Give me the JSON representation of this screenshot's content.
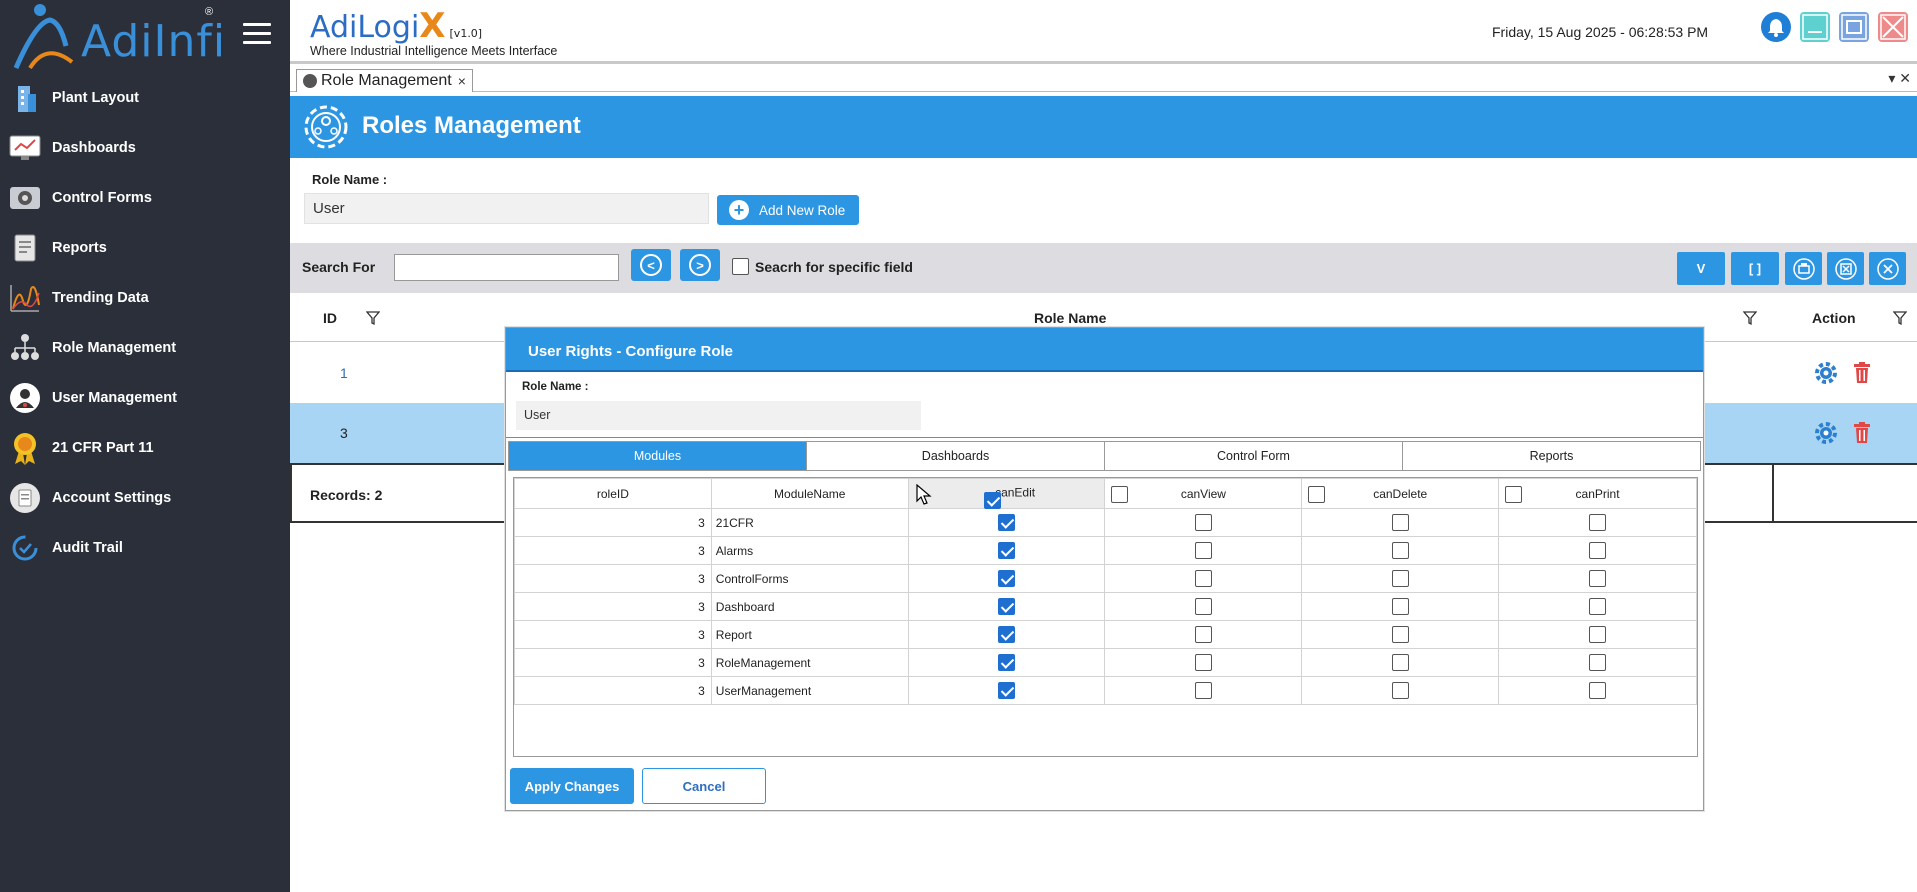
{
  "app": {
    "logo_text_a": "Adi",
    "logo_text_b": "Infi",
    "logo_reg": "®",
    "brand_name": "AdiLogi",
    "brand_x": "X",
    "brand_version": "[v1.0]",
    "brand_tagline": "Where Industrial Intelligence Meets Interface",
    "datetime": "Friday, 15 Aug 2025 - 06:28:53 PM"
  },
  "sidebar": {
    "items": [
      {
        "label": "Plant Layout",
        "icon": "building-icon"
      },
      {
        "label": "Dashboards",
        "icon": "monitor-icon"
      },
      {
        "label": "Control Forms",
        "icon": "control-forms-icon"
      },
      {
        "label": "Reports",
        "icon": "reports-icon"
      },
      {
        "label": "Trending Data",
        "icon": "trend-chart-icon"
      },
      {
        "label": "Role Management",
        "icon": "org-chart-icon"
      },
      {
        "label": "User Management",
        "icon": "user-icon"
      },
      {
        "label": "21 CFR Part 11",
        "icon": "award-badge-icon"
      },
      {
        "label": "Account Settings",
        "icon": "account-settings-icon"
      },
      {
        "label": "Audit Trail",
        "icon": "audit-icon"
      }
    ]
  },
  "doc_tab": {
    "label": "Role Management",
    "close": "×"
  },
  "strip_icons": "▾  ✕",
  "page": {
    "title": "Roles Management",
    "role_name_label": "Role Name :",
    "role_name_value": "User",
    "add_role_label": "Add New Role",
    "plus": "+"
  },
  "search": {
    "label": "Search For",
    "value": "",
    "prev": "<",
    "next": ">",
    "specific_field_label": "Seacrh for specific field",
    "tools": {
      "v": "V",
      "brackets": "[ ]"
    }
  },
  "grid": {
    "headers": {
      "id": "ID",
      "role_name": "Role Name",
      "action": "Action"
    },
    "rows": [
      {
        "id": "1"
      },
      {
        "id": "3"
      }
    ],
    "records_label": "Records: 2"
  },
  "modal": {
    "title": "User Rights - Configure Role",
    "role_name_label": "Role Name :",
    "role_name_value": "User",
    "tabs": [
      "Modules",
      "Dashboards",
      "Control Form",
      "Reports"
    ],
    "active_tab": "Modules",
    "columns": [
      "roleID",
      "ModuleName",
      "canEdit",
      "canView",
      "canDelete",
      "canPrint"
    ],
    "rows": [
      {
        "roleID": "3",
        "ModuleName": "21CFR",
        "canEdit": true,
        "canView": false,
        "canDelete": false,
        "canPrint": false
      },
      {
        "roleID": "3",
        "ModuleName": "Alarms",
        "canEdit": true,
        "canView": false,
        "canDelete": false,
        "canPrint": false
      },
      {
        "roleID": "3",
        "ModuleName": "ControlForms",
        "canEdit": true,
        "canView": false,
        "canDelete": false,
        "canPrint": false
      },
      {
        "roleID": "3",
        "ModuleName": "Dashboard",
        "canEdit": true,
        "canView": false,
        "canDelete": false,
        "canPrint": false
      },
      {
        "roleID": "3",
        "ModuleName": "Report",
        "canEdit": true,
        "canView": false,
        "canDelete": false,
        "canPrint": false
      },
      {
        "roleID": "3",
        "ModuleName": "RoleManagement",
        "canEdit": true,
        "canView": false,
        "canDelete": false,
        "canPrint": false
      },
      {
        "roleID": "3",
        "ModuleName": "UserManagement",
        "canEdit": true,
        "canView": false,
        "canDelete": false,
        "canPrint": false
      }
    ],
    "apply_label": "Apply Changes",
    "cancel_label": "Cancel"
  },
  "colors": {
    "accent": "#2d96e2",
    "sidebar_bg": "#2b2f3a",
    "selected_row": "#a9d5f5",
    "delete_red": "#e04848"
  }
}
